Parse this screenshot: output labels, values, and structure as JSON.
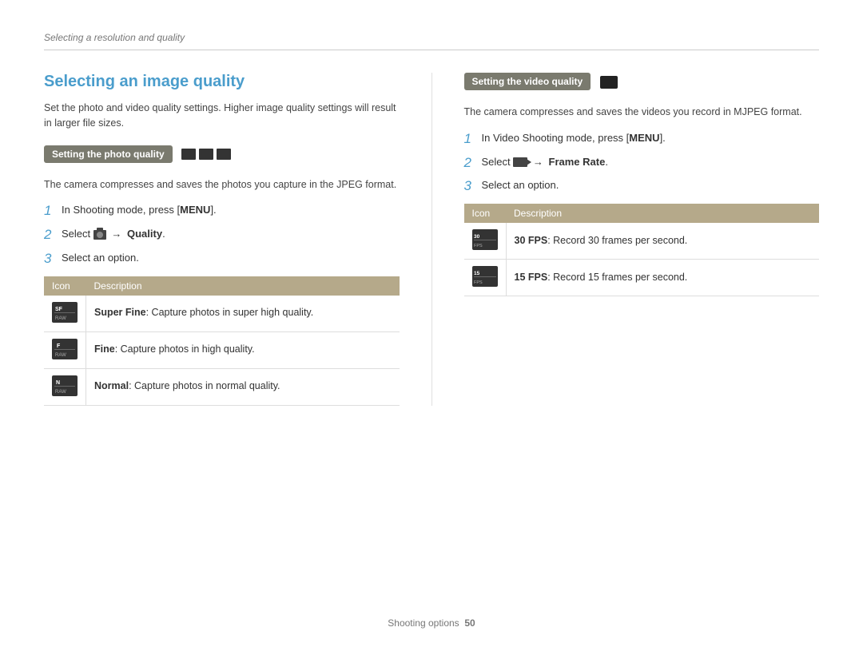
{
  "breadcrumb": {
    "text": "Selecting a resolution and quality"
  },
  "left_column": {
    "section_title": "Selecting an image quality",
    "intro_text": "Set the photo and video quality settings. Higher image quality settings will result in larger file sizes.",
    "photo_quality": {
      "badge_label": "Setting the photo quality",
      "description": "The camera compresses and saves the photos you capture in the JPEG format.",
      "steps": [
        {
          "num": "1",
          "text": "In Shooting mode, press [",
          "bold": "MENU",
          "text2": "]."
        },
        {
          "num": "2",
          "text": "Select ",
          "icon": "camera",
          "arrow": "→",
          "bold": "Quality",
          "text2": "."
        },
        {
          "num": "3",
          "text": "Select an option."
        }
      ],
      "table": {
        "headers": [
          "Icon",
          "Description"
        ],
        "rows": [
          {
            "icon_label": "SF",
            "description_bold": "Super Fine",
            "description_text": ": Capture photos in super high quality."
          },
          {
            "icon_label": "F",
            "description_bold": "Fine",
            "description_text": ": Capture photos in high quality."
          },
          {
            "icon_label": "N",
            "description_bold": "Normal",
            "description_text": ": Capture photos in normal quality."
          }
        ]
      }
    }
  },
  "right_column": {
    "video_quality": {
      "badge_label": "Setting the video quality",
      "description": "The camera compresses and saves the videos you record in MJPEG format.",
      "steps": [
        {
          "num": "1",
          "text": "In Video Shooting mode, press [",
          "bold": "MENU",
          "text2": "]."
        },
        {
          "num": "2",
          "text": "Select ",
          "icon": "video",
          "arrow": "→",
          "bold": "Frame Rate",
          "text2": "."
        },
        {
          "num": "3",
          "text": "Select an option."
        }
      ],
      "table": {
        "headers": [
          "Icon",
          "Description"
        ],
        "rows": [
          {
            "icon_label": "30",
            "description_bold": "30 FPS",
            "description_text": ": Record 30 frames per second."
          },
          {
            "icon_label": "15",
            "description_bold": "15 FPS",
            "description_text": ": Record 15 frames per second."
          }
        ]
      }
    }
  },
  "footer": {
    "text": "Shooting options",
    "page_num": "50"
  }
}
